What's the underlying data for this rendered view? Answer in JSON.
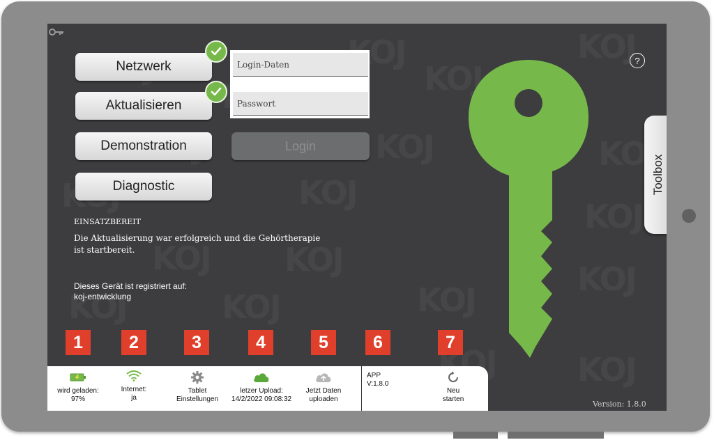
{
  "login": {
    "user_placeholder": "Login-Daten",
    "password_placeholder": "Passwort",
    "login_label": "Login"
  },
  "menu": {
    "network_label": "Netzwerk",
    "update_label": "Aktualisieren",
    "demo_label": "Demonstration",
    "diagnostic_label": "Diagnostic"
  },
  "status": {
    "title": "EINSATZBEREIT",
    "message": "Die Aktualisierung war erfolgreich und die Gehörtherapie ist startbereit.",
    "registered_label": "Dieses Gerät ist registriert auf:",
    "registered_value": "koj-entwicklung"
  },
  "help_symbol": "?",
  "toolbox_label": "Toolbox",
  "numbers": [
    "1",
    "2",
    "3",
    "4",
    "5",
    "6",
    "7"
  ],
  "bottom_bar": {
    "battery_label": "wird geladen:",
    "battery_value": "97%",
    "internet_label": "Internet:",
    "internet_value": "ja",
    "settings_line1": "Tablet",
    "settings_line2": "Einstellungen",
    "upload_label": "letzer Upload:",
    "upload_value": "14/2/2022 09:08:32",
    "upload_now_line1": "Jetzt Daten",
    "upload_now_line2": "uploaden",
    "app_label": "APP",
    "app_version": "V:1.8.0",
    "restart_line1": "Neu",
    "restart_line2": "starten"
  },
  "footer_version": "Version: 1.8.0",
  "watermark_text": "KOJ",
  "colors": {
    "accent_green": "#76b94a",
    "number_red": "#e0402b",
    "screen_bg": "#3d3d3f"
  },
  "icons": [
    "key-icon",
    "check-icon",
    "help-icon",
    "battery-icon",
    "wifi-icon",
    "gear-icon",
    "cloud-icon",
    "cloud-upload-icon",
    "refresh-icon"
  ]
}
